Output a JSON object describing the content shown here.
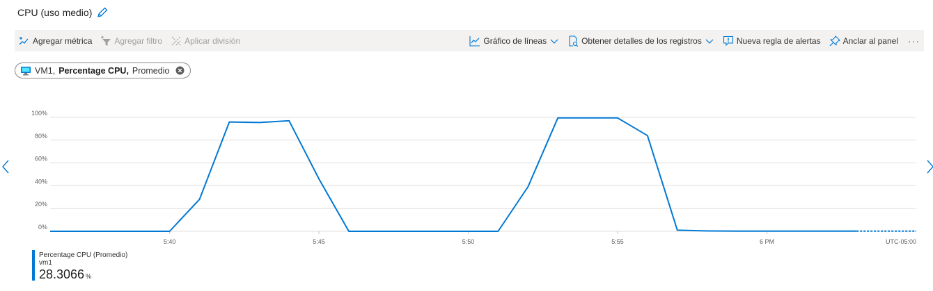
{
  "page": {
    "title": "CPU (uso medio)"
  },
  "toolbar": {
    "add_metric": "Agregar métrica",
    "add_filter": "Agregar filtro",
    "apply_split": "Aplicar división",
    "line_chart": "Gráfico de líneas",
    "get_logs": "Obtener detalles de los registros",
    "new_alert": "Nueva regla de alertas",
    "pin": "Anclar al panel",
    "more": "···"
  },
  "metric_pill": {
    "resource": "VM1,",
    "metric": "Percentage CPU,",
    "aggregation": "Promedio"
  },
  "legend": {
    "name": "Percentage CPU (Promedio)",
    "resource": "vm1",
    "value": "28.3066",
    "unit": "%"
  },
  "colors": {
    "accent": "#0078d4",
    "toolbar_bg": "#f3f2f1",
    "grid": "#e1dfdd"
  },
  "chart_data": {
    "type": "line",
    "title": "",
    "xlabel": "",
    "ylabel": "",
    "ylim": [
      0,
      100
    ],
    "y_ticks": [
      0,
      20,
      40,
      60,
      80,
      100
    ],
    "y_tick_labels": [
      "0%",
      "20%",
      "40%",
      "60%",
      "80%",
      "100%"
    ],
    "x_range_minutes": [
      5.0,
      34.0
    ],
    "x_tick_minutes": [
      9,
      14,
      19,
      24,
      29
    ],
    "x_tick_labels": [
      "5:40",
      "5:45",
      "5:50",
      "5:55",
      "6 PM"
    ],
    "timezone_label": "UTC-05:00",
    "grid": true,
    "series": [
      {
        "name": "Percentage CPU (Promedio)",
        "color": "#0078d4",
        "x_minutes": [
          5,
          6,
          7,
          8,
          9,
          10,
          11,
          12,
          13,
          14,
          15,
          16,
          17,
          18,
          19,
          20,
          21,
          22,
          23,
          24,
          25,
          26,
          27,
          28,
          29,
          30,
          31,
          32
        ],
        "values": [
          0,
          0,
          0,
          0,
          0,
          28,
          96,
          95.5,
          97,
          46,
          0,
          0,
          0,
          0,
          0,
          0,
          39,
          99.5,
          99.5,
          99.5,
          84,
          1,
          0.3,
          0.2,
          0.2,
          0.2,
          0.2,
          0.2
        ],
        "dashed_x_minutes": [
          32,
          33,
          34
        ],
        "dashed_values": [
          0.2,
          0.2,
          0.2
        ]
      }
    ]
  }
}
